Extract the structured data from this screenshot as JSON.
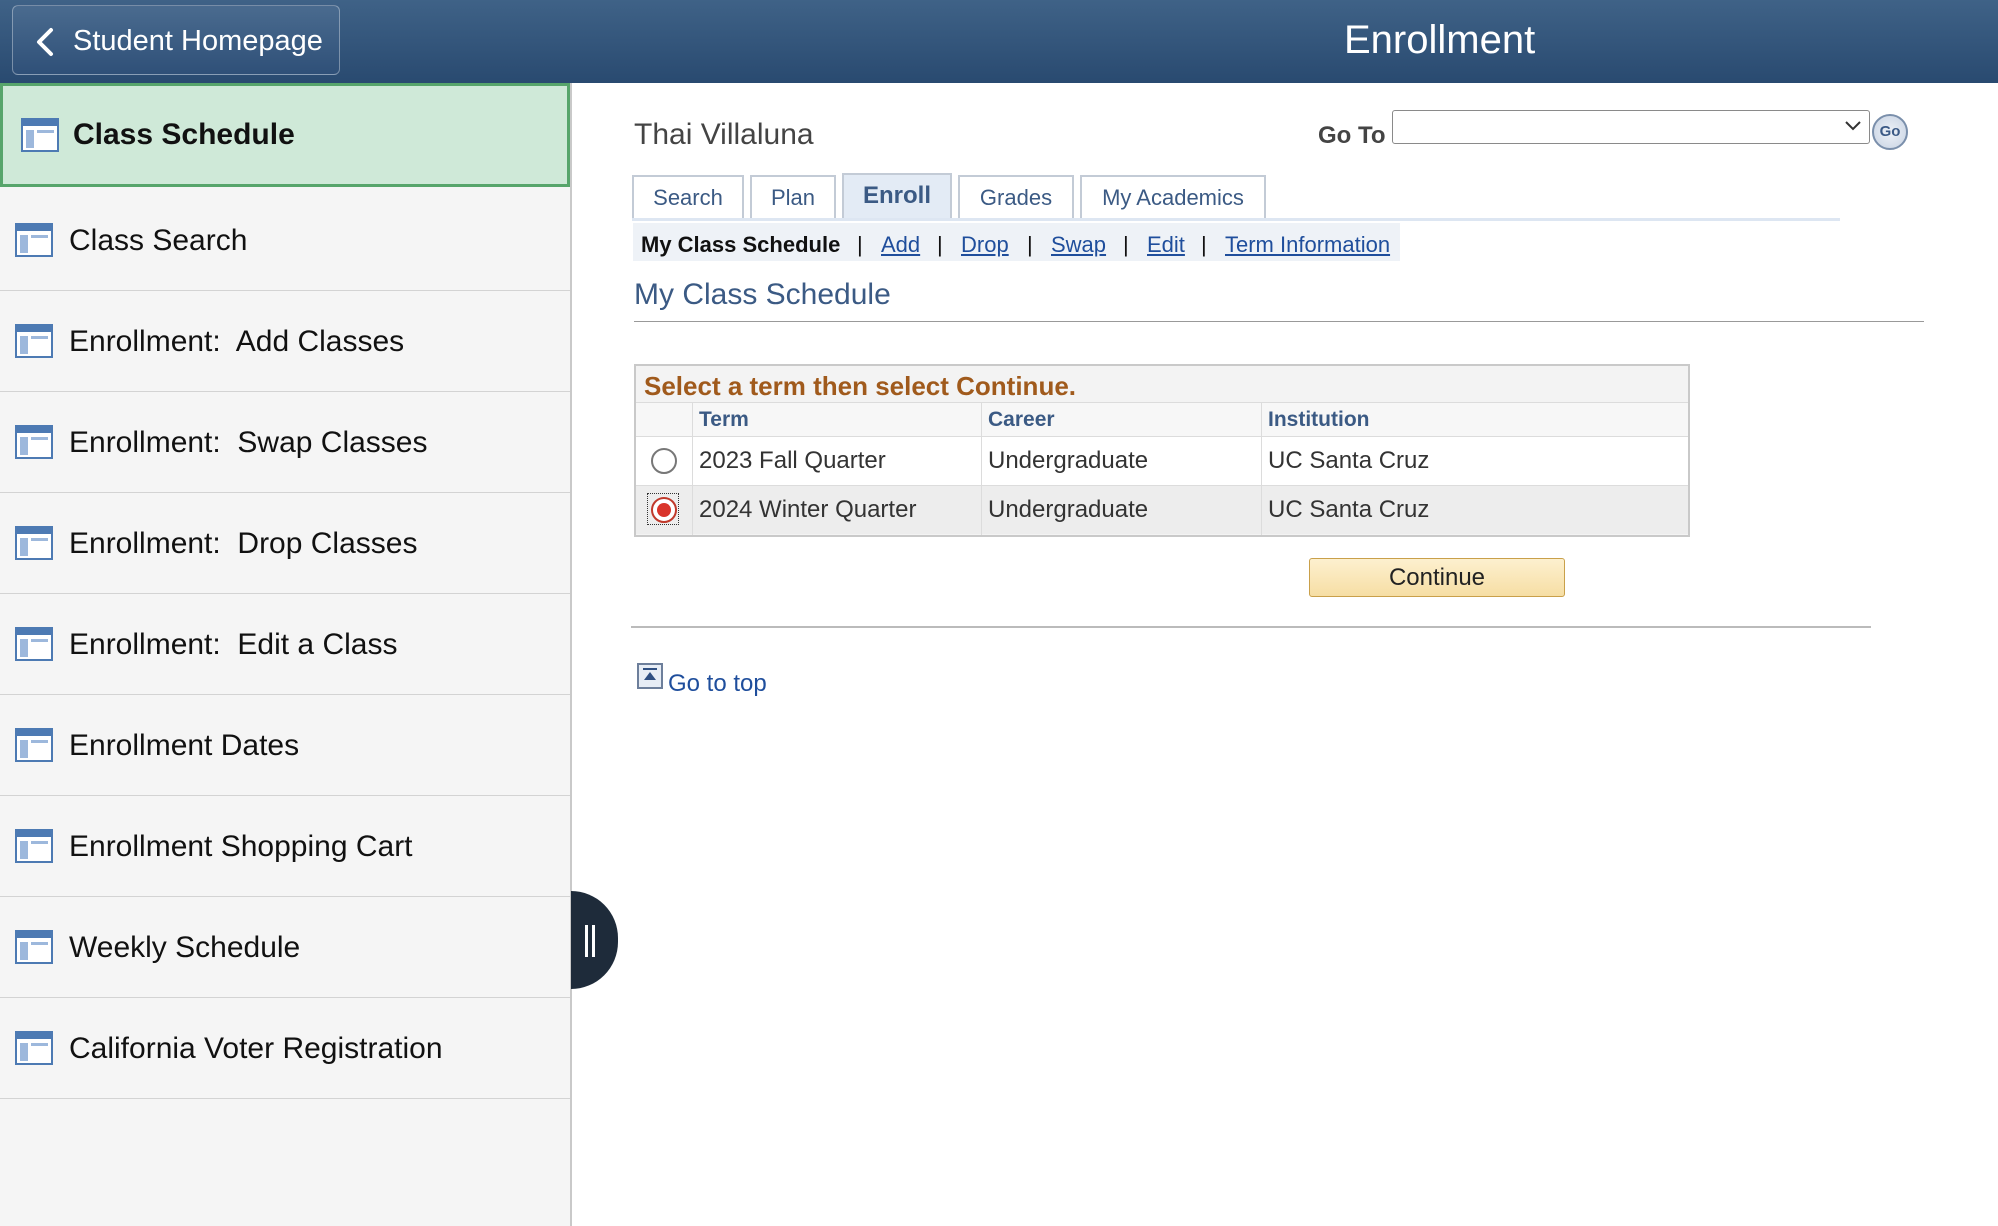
{
  "header": {
    "back_label": "Student Homepage",
    "title": "Enrollment"
  },
  "sidebar": {
    "items": [
      {
        "label": "Class Schedule",
        "active": true
      },
      {
        "label": "Class Search"
      },
      {
        "label": "Enrollment:  Add Classes"
      },
      {
        "label": "Enrollment:  Swap Classes"
      },
      {
        "label": "Enrollment:  Drop Classes"
      },
      {
        "label": "Enrollment:  Edit a Class"
      },
      {
        "label": "Enrollment Dates"
      },
      {
        "label": "Enrollment Shopping Cart"
      },
      {
        "label": "Weekly Schedule"
      },
      {
        "label": "California Voter Registration"
      }
    ]
  },
  "main": {
    "student_name": "Thai Villaluna",
    "goto": {
      "label": "Go To",
      "value": "",
      "go_label": "Go"
    },
    "tabs": [
      {
        "label": "Search"
      },
      {
        "label": "Plan"
      },
      {
        "label": "Enroll",
        "active": true
      },
      {
        "label": "Grades"
      },
      {
        "label": "My Academics"
      }
    ],
    "subnav": {
      "current": "My Class Schedule",
      "links": [
        "Add",
        "Drop",
        "Swap",
        "Edit",
        "Term Information"
      ],
      "separator": "|"
    },
    "section_title": "My Class Schedule",
    "term_grid": {
      "title": "Select a term then select Continue.",
      "headers": [
        "Term",
        "Career",
        "Institution"
      ],
      "rows": [
        {
          "term": "2023 Fall Quarter",
          "career": "Undergraduate",
          "institution": "UC Santa Cruz",
          "selected": false
        },
        {
          "term": "2024 Winter Quarter",
          "career": "Undergraduate",
          "institution": "UC Santa Cruz",
          "selected": true
        }
      ]
    },
    "continue_label": "Continue",
    "go_to_top": "Go to top"
  }
}
